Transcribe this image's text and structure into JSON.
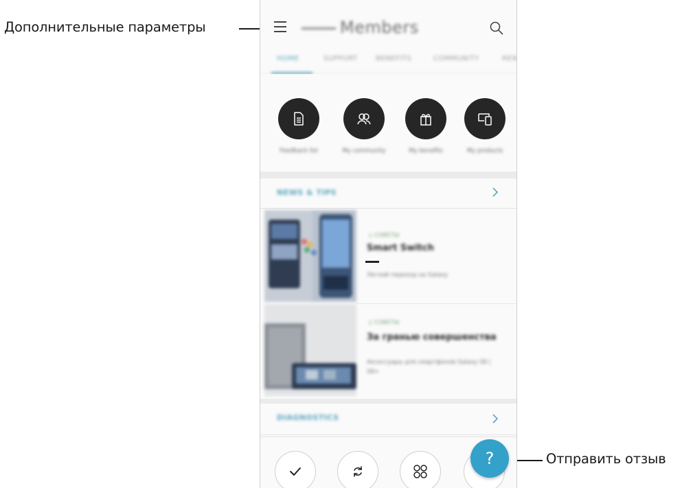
{
  "callouts": {
    "more_options": "Дополнительные параметры",
    "send_feedback": "Отправить отзыв"
  },
  "appbar": {
    "title": "Members",
    "menu_icon": "hamburger-menu-icon",
    "search_icon": "search-icon"
  },
  "tabs": [
    "HOME",
    "SUPPORT",
    "BENEFITS",
    "COMMUNITY",
    "REWARDS"
  ],
  "quick_actions": [
    {
      "label": "Feedback list",
      "icon": "document-list-icon"
    },
    {
      "label": "My community",
      "icon": "people-icon"
    },
    {
      "label": "My benefits",
      "icon": "gift-icon"
    },
    {
      "label": "My products",
      "icon": "devices-icon"
    }
  ],
  "news_section": {
    "title": "NEWS & TIPS"
  },
  "news_items": [
    {
      "tag": "СОВЕТЫ",
      "title": "Smart Switch",
      "description": "Легкий переход на Galaxy"
    },
    {
      "tag": "СОВЕТЫ",
      "title": "За гранью совершенства",
      "description": "Аксессуары для смартфонов Galaxy S8 | S8+"
    }
  ],
  "diagnostics_section": {
    "title": "DIAGNOSTICS"
  },
  "bottom_actions": [
    {
      "icon": "check-icon"
    },
    {
      "icon": "refresh-icon"
    },
    {
      "icon": "apps-grid-icon"
    }
  ],
  "fab": {
    "label": "?",
    "icon": "help-icon"
  },
  "colors": {
    "accent": "#5aa6bd",
    "fab": "#33a1c9",
    "dark_circle": "#262626"
  }
}
